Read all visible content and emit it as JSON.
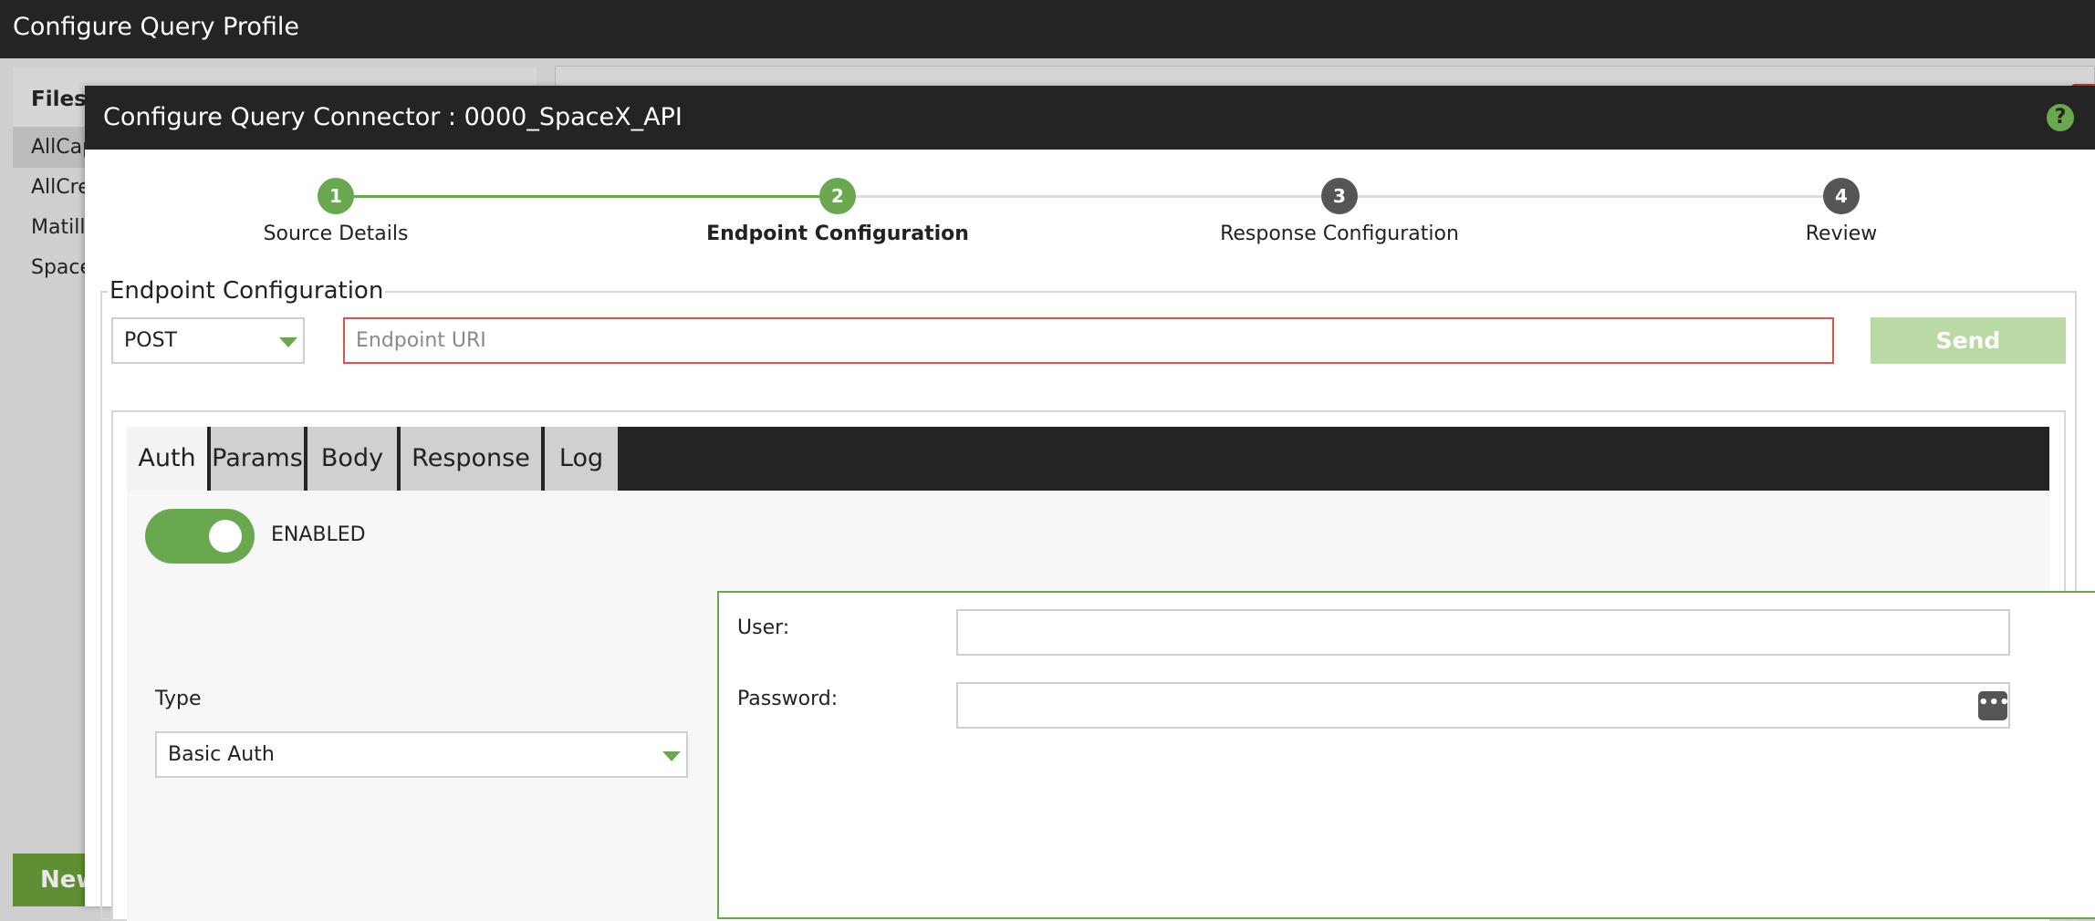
{
  "app": {
    "title": "Configure Query Profile"
  },
  "files_panel": {
    "header": "Files",
    "items": [
      "AllCap",
      "AllCre",
      "Matilli",
      "Space"
    ],
    "new_button": "New"
  },
  "modal": {
    "title": "Configure Query Connector : 0000_SpaceX_API",
    "help_icon": "?"
  },
  "stepper": {
    "steps": [
      {
        "number": "1",
        "label": "Source Details"
      },
      {
        "number": "2",
        "label": "Endpoint Configuration"
      },
      {
        "number": "3",
        "label": "Response Configuration"
      },
      {
        "number": "4",
        "label": "Review"
      }
    ],
    "current_step": 2
  },
  "endpoint": {
    "legend": "Endpoint Configuration",
    "method": "POST",
    "uri_value": "",
    "uri_placeholder": "Endpoint URI",
    "send_label": "Send"
  },
  "tabs": [
    "Auth",
    "Params",
    "Body",
    "Response",
    "Log"
  ],
  "active_tab": "Auth",
  "auth": {
    "toggle_label": "ENABLED",
    "toggle_on": true,
    "type_label": "Type",
    "type_value": "Basic Auth",
    "user_label": "User:",
    "user_value": "",
    "password_label": "Password:",
    "password_value": "",
    "reveal_icon": "•••"
  },
  "colors": {
    "accent_green": "#6aa84f",
    "dark_bar": "#242424",
    "error_border": "#d9534f",
    "send_disabled": "#b9d9a5",
    "step_pending": "#555555"
  }
}
